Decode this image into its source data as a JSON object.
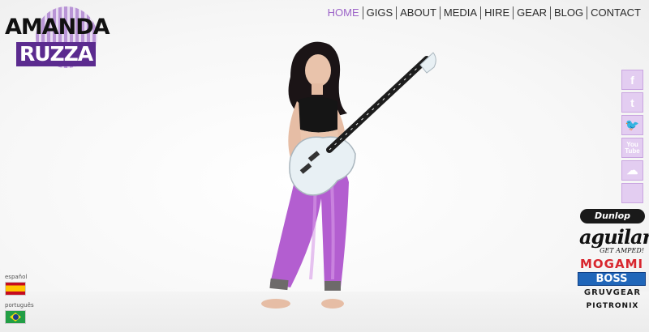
{
  "logo": {
    "line1": "AMANDA",
    "line2": "RUZZA",
    "accent": "#5b2b8f"
  },
  "nav": {
    "items": [
      {
        "label": "HOME",
        "active": true
      },
      {
        "label": "GIGS",
        "active": false
      },
      {
        "label": "ABOUT",
        "active": false
      },
      {
        "label": "MEDIA",
        "active": false
      },
      {
        "label": "HIRE",
        "active": false
      },
      {
        "label": "GEAR",
        "active": false
      },
      {
        "label": "BLOG",
        "active": false
      },
      {
        "label": "CONTACT",
        "active": false
      }
    ],
    "active_color": "#9c63c8"
  },
  "social": [
    {
      "icon": "facebook-icon",
      "glyph": "f"
    },
    {
      "icon": "tumblr-icon",
      "glyph": "t"
    },
    {
      "icon": "twitter-icon",
      "glyph": "🐦"
    },
    {
      "icon": "youtube-icon",
      "glyph": "You Tube"
    },
    {
      "icon": "soundcloud-icon",
      "glyph": "☁"
    },
    {
      "icon": "apple-icon",
      "glyph": ""
    }
  ],
  "sponsors": {
    "dunlop": "Dunlop",
    "aguilar": "aguilar",
    "aguilar_tagline": "GET AMPED!",
    "mogami": "MOGAMI",
    "boss": "BOSS",
    "gruvgear": "GRUVGEAR",
    "pigtronix": "PIGTRONIX"
  },
  "languages": [
    {
      "label": "español",
      "flag": "spain-flag-icon"
    },
    {
      "label": "português",
      "flag": "brazil-flag-icon"
    }
  ]
}
